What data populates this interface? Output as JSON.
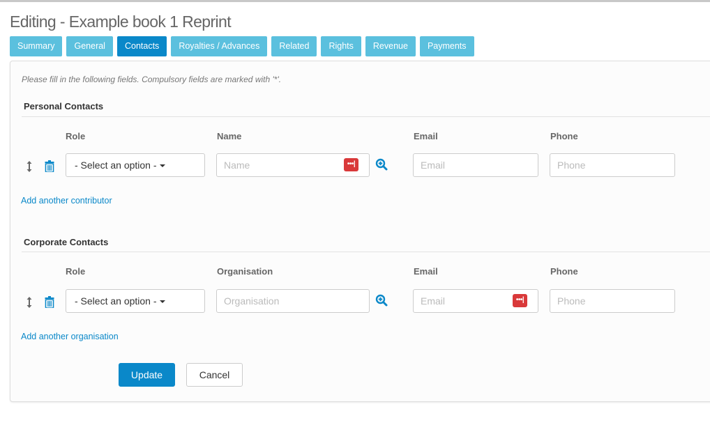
{
  "page": {
    "title": "Editing - Example book 1 Reprint"
  },
  "tabs": [
    {
      "label": "Summary",
      "active": false
    },
    {
      "label": "General",
      "active": false
    },
    {
      "label": "Contacts",
      "active": true
    },
    {
      "label": "Royalties / Advances",
      "active": false
    },
    {
      "label": "Related",
      "active": false
    },
    {
      "label": "Rights",
      "active": false
    },
    {
      "label": "Revenue",
      "active": false
    },
    {
      "label": "Payments",
      "active": false
    }
  ],
  "form": {
    "hint": "Please fill in the following fields. Compulsory fields are marked with '*'.",
    "personal": {
      "title": "Personal Contacts",
      "columns": {
        "role": "Role",
        "name": "Name",
        "email": "Email",
        "phone": "Phone"
      },
      "row": {
        "role_value": "- Select an option -",
        "name_placeholder": "Name",
        "email_placeholder": "Email",
        "phone_placeholder": "Phone",
        "password_manager_badge": "•••|"
      },
      "add_link": "Add another contributor"
    },
    "corporate": {
      "title": "Corporate Contacts",
      "columns": {
        "role": "Role",
        "organisation": "Organisation",
        "email": "Email",
        "phone": "Phone"
      },
      "row": {
        "role_value": "- Select an option -",
        "organisation_placeholder": "Organisation",
        "email_placeholder": "Email",
        "phone_placeholder": "Phone",
        "password_manager_badge": "•••|"
      },
      "add_link": "Add another organisation"
    },
    "buttons": {
      "update": "Update",
      "cancel": "Cancel"
    }
  },
  "colors": {
    "tab": "#5bc0de",
    "tab_active": "#0a88c9",
    "primary": "#0a88c9",
    "link": "#0a88c9",
    "badge": "#d9393a"
  }
}
